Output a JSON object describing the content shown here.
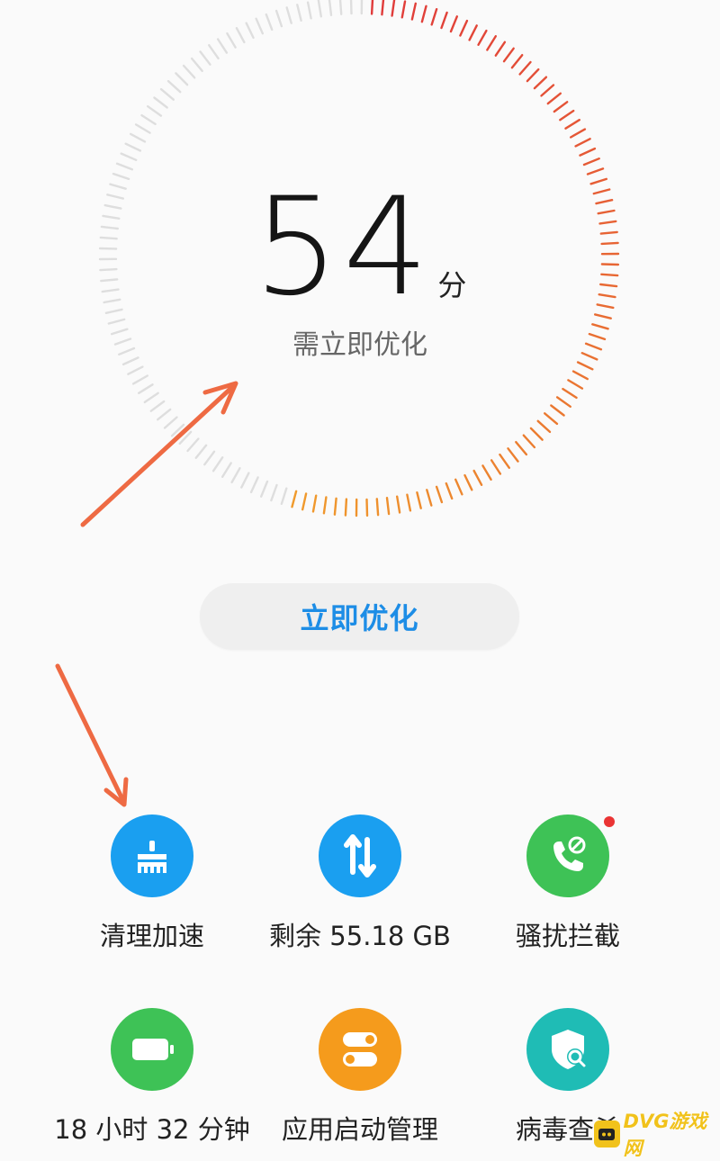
{
  "score": {
    "value": "54",
    "unit": "分",
    "status": "需立即优化",
    "fraction": 0.54
  },
  "optimize_button": {
    "label": "立即优化"
  },
  "tiles": [
    {
      "label": "清理加速",
      "icon": "broom-icon",
      "color": "#1a9ff0"
    },
    {
      "label": "剩余 55.18 GB",
      "icon": "transfer-arrows-icon",
      "color": "#1a9ff0"
    },
    {
      "label": "骚扰拦截",
      "icon": "phone-block-icon",
      "color": "#3ec256",
      "badge": true
    },
    {
      "label": "18 小时 32 分钟",
      "icon": "battery-icon",
      "color": "#3ec256"
    },
    {
      "label": "应用启动管理",
      "icon": "toggle-switches-icon",
      "color": "#f59b1c"
    },
    {
      "label": "病毒查杀",
      "icon": "shield-search-icon",
      "color": "#1fbcb5"
    }
  ],
  "annotations": {
    "arrow_color": "#ee6a43"
  },
  "watermark": {
    "text": "DVG游戏网"
  },
  "colors": {
    "accent": "#1d8de6",
    "gauge_active_start": "#e03a3a",
    "gauge_active_end": "#f09a2c",
    "gauge_inactive": "#dedede"
  }
}
